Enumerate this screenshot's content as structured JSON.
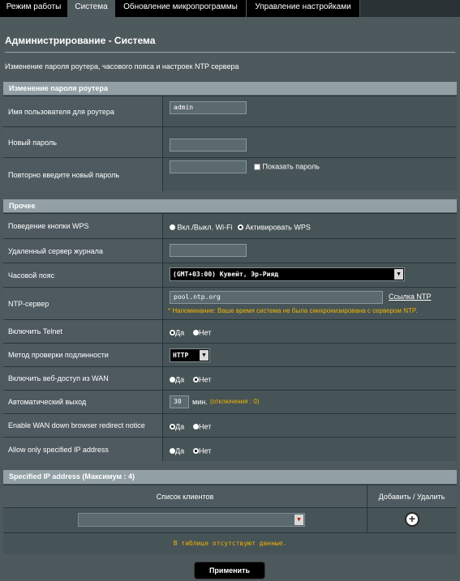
{
  "tabs": [
    "Режим работы",
    "Система",
    "Обновление микропрограммы",
    "Управление настройками"
  ],
  "page": {
    "title": "Администрирование - Система",
    "description": "Изменение пароля роутера, часового пояса и настроек NTP сервера"
  },
  "password_section": {
    "header": "Изменение пароля роутера",
    "username_label": "Имя пользователя для роутера",
    "username_value": "admin",
    "new_password_label": "Новый пароль",
    "new_password_value": "",
    "repeat_password_label": "Повторно введите новый пароль",
    "repeat_password_value": "",
    "show_password_label": "Показать пароль"
  },
  "misc_section": {
    "header": "Прочее",
    "wps_label": "Поведение кнопки WPS",
    "wps_option1": "Вкл./Выкл. Wi-Fi",
    "wps_option2": "Активировать WPS",
    "log_server_label": "Удаленный сервер журнала",
    "log_server_value": "",
    "timezone_label": "Часовой пояс",
    "timezone_value": "(GMT+03:00) Кувейт, Эр-Рияд",
    "ntp_label": "NTP-сервер",
    "ntp_value": "pool.ntp.org",
    "ntp_link": "Ссылка NTP",
    "ntp_warning": "* Напоминание: Ваше время система не была синхронизирована с сервером NTP.",
    "telnet_label": "Включить Telnet",
    "auth_label": "Метод проверки подлинности",
    "auth_value": "HTTP",
    "wan_access_label": "Включить веб-доступ из WAN",
    "autologout_label": "Автоматический выход",
    "autologout_value": "30",
    "autologout_unit": "мин.",
    "autologout_note": "(отключения : 0)",
    "wan_redirect_label": "Enable WAN down browser redirect notice",
    "allow_ip_label": "Allow only specified IP address",
    "yes": "Да",
    "no": "Нет"
  },
  "ip_section": {
    "header": "Specified IP address (Максимум : 4)",
    "col_clients": "Список клиентов",
    "col_action": "Добавить / Удалить",
    "empty_text": "В таблице отсутствуют данные."
  },
  "apply_label": "Применить",
  "colors": {
    "background": "#4d595d",
    "section_header": "#92a0a5",
    "warning": "#f0b400"
  }
}
